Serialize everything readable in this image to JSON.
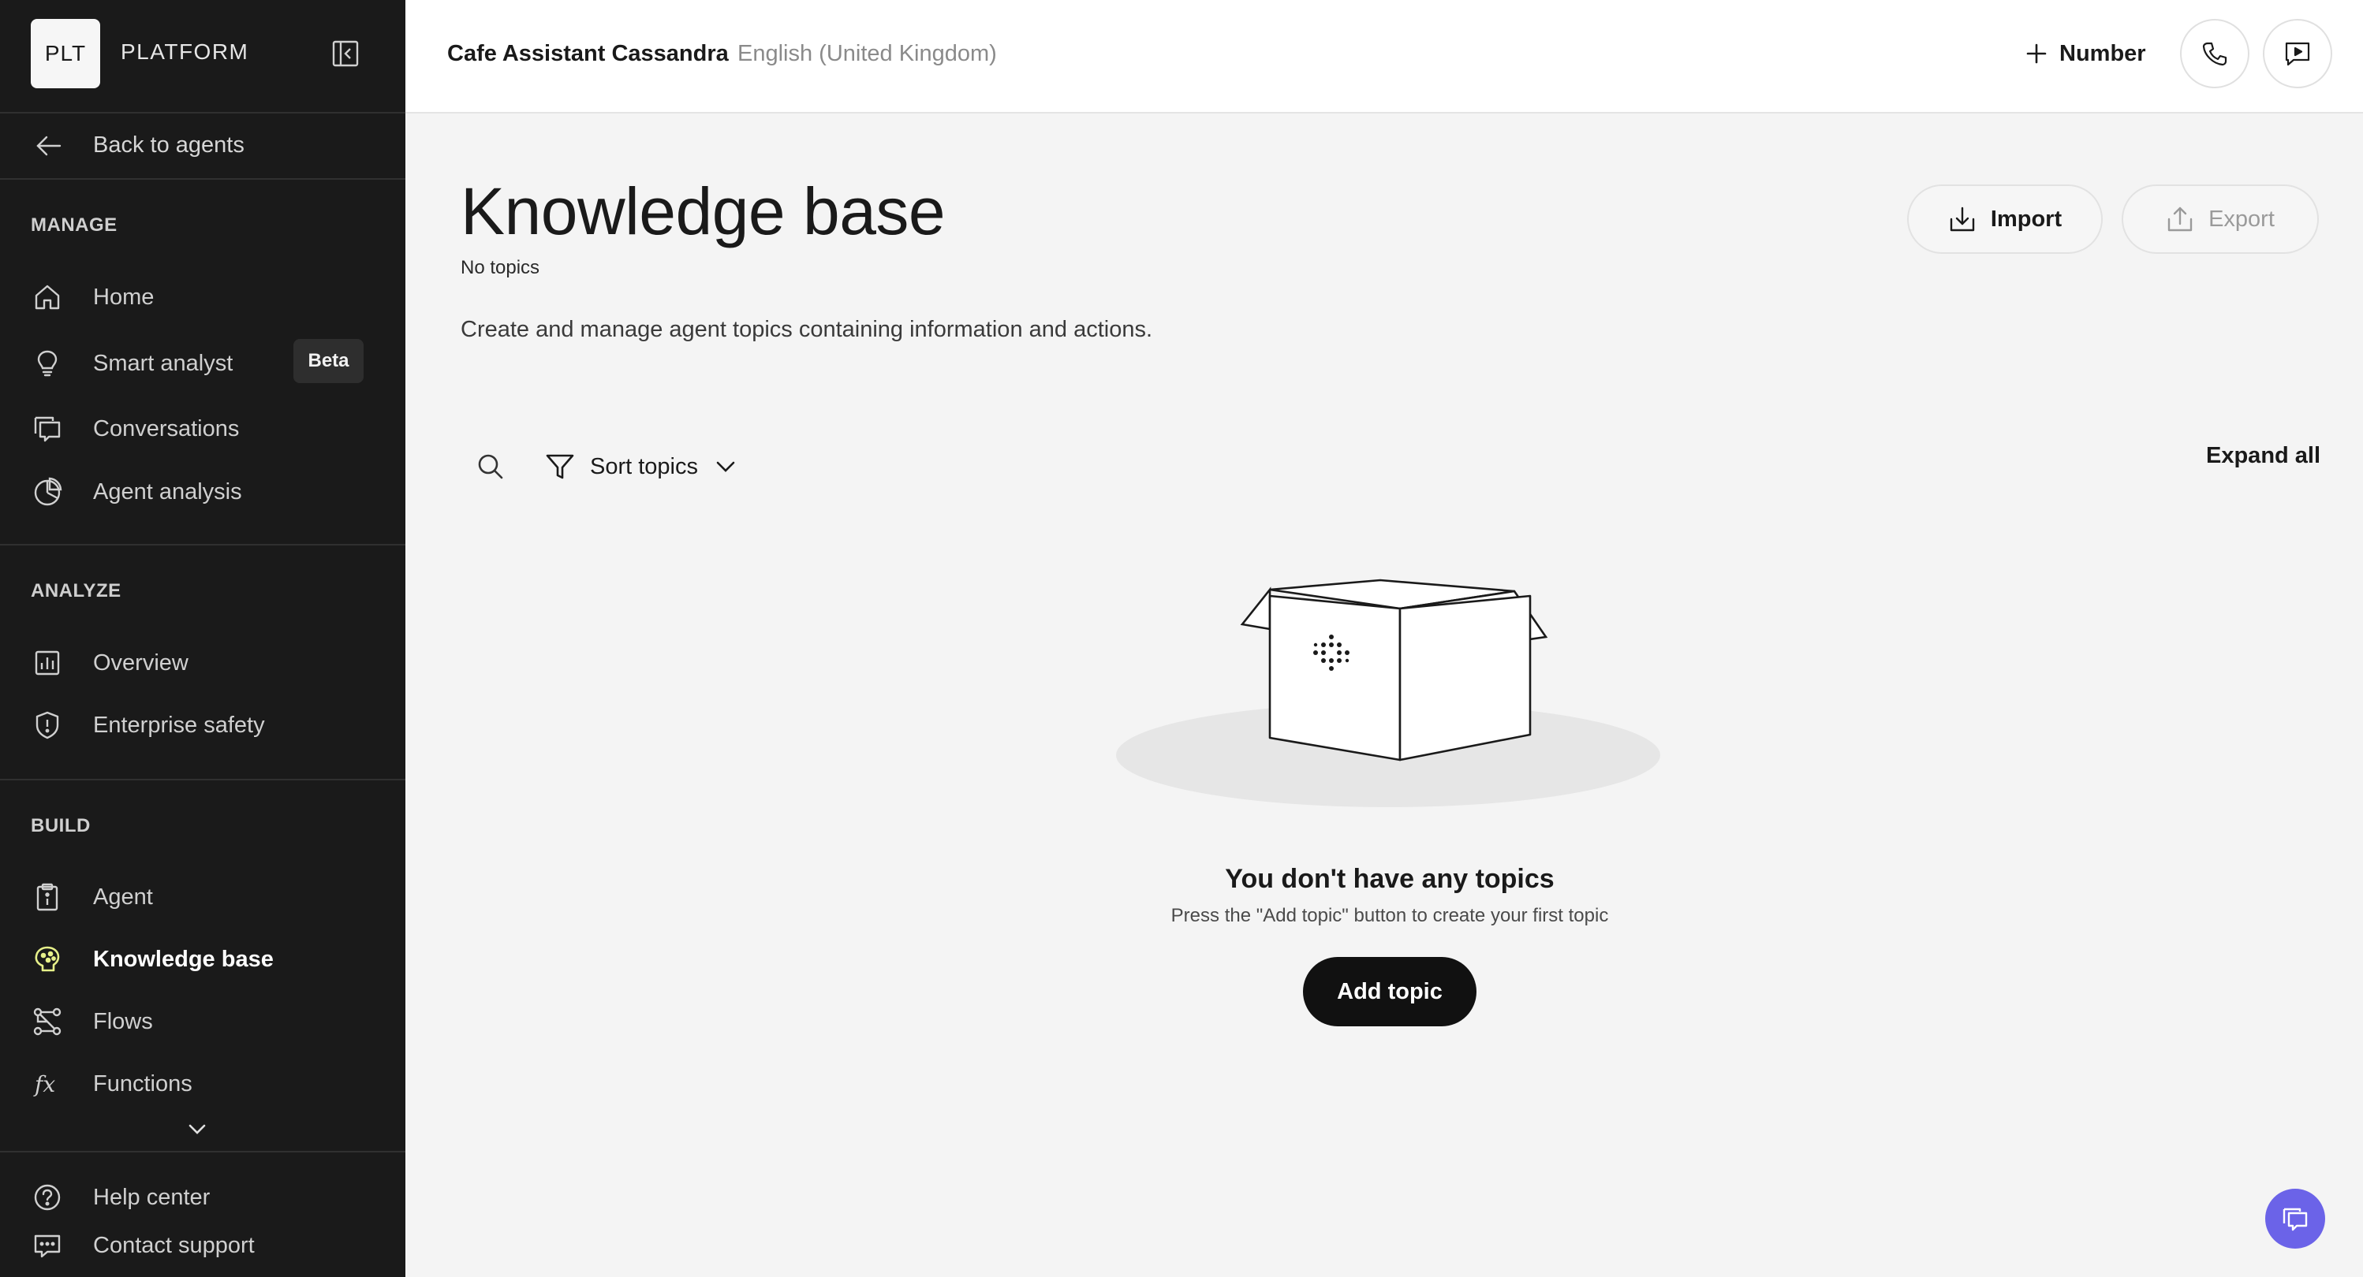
{
  "sidebar": {
    "logo": "PLT",
    "brand": "PLATFORM",
    "back_label": "Back to agents",
    "sections": {
      "manage": "MANAGE",
      "analyze": "ANALYZE",
      "build": "BUILD"
    },
    "manage_items": [
      {
        "label": "Home",
        "icon": "home-icon"
      },
      {
        "label": "Smart analyst",
        "icon": "lightbulb-icon",
        "badge": "Beta"
      },
      {
        "label": "Conversations",
        "icon": "conversations-icon"
      },
      {
        "label": "Agent analysis",
        "icon": "pie-chart-icon"
      }
    ],
    "analyze_items": [
      {
        "label": "Overview",
        "icon": "bar-chart-icon"
      },
      {
        "label": "Enterprise safety",
        "icon": "shield-icon"
      }
    ],
    "build_items": [
      {
        "label": "Agent",
        "icon": "clipboard-icon"
      },
      {
        "label": "Knowledge base",
        "icon": "brain-icon",
        "active": true
      },
      {
        "label": "Flows",
        "icon": "flows-icon"
      },
      {
        "label": "Functions",
        "icon": "function-icon"
      }
    ],
    "footer_items": [
      {
        "label": "Help center",
        "icon": "help-icon"
      },
      {
        "label": "Contact support",
        "icon": "support-chat-icon"
      }
    ]
  },
  "topbar": {
    "agent_name": "Cafe Assistant Cassandra",
    "agent_language": "English (United Kingdom)",
    "number_label": "Number"
  },
  "main": {
    "title": "Knowledge base",
    "topic_count": "No topics",
    "description": "Create and manage agent topics containing information and actions.",
    "import_label": "Import",
    "export_label": "Export",
    "sort_label": "Sort topics",
    "expand_all_label": "Expand all",
    "empty_title": "You don't have any topics",
    "empty_subtitle": "Press the \"Add topic\" button to create your first topic",
    "add_topic_label": "Add topic"
  },
  "colors": {
    "sidebar_bg": "#1a1a1a",
    "active_icon": "#e6f08a",
    "fab": "#6b63e8",
    "primary_button": "#111111"
  }
}
